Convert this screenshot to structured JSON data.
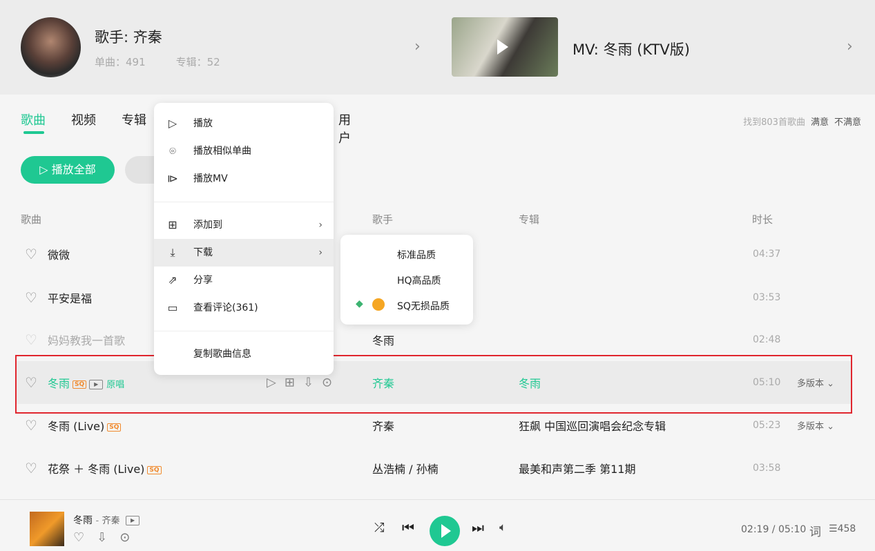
{
  "header": {
    "singer": "歌手: 齐秦",
    "singles": "单曲：491",
    "albums": "专辑：52",
    "mv_title": "MV: 冬雨 (KTV版)"
  },
  "tabs": [
    "歌曲",
    "视频",
    "专辑",
    "用户"
  ],
  "found": {
    "text": "找到803首歌曲",
    "satisfied": "满意",
    "unsatisfied": "不满意"
  },
  "play_all": "播放全部",
  "columns": {
    "song": "歌曲",
    "singer": "歌手",
    "album": "专辑",
    "duration": "时长"
  },
  "rows": [
    {
      "title": "微微",
      "singer": "",
      "album": "",
      "duration": "04:37"
    },
    {
      "title": "平安是福",
      "singer": "",
      "album": "",
      "duration": "03:53"
    },
    {
      "title": "妈妈教我一首歌",
      "singer": "冬雨",
      "album": "",
      "duration": "02:48"
    },
    {
      "title": "冬雨",
      "tag": "原唱",
      "singer": "齐秦",
      "album": "冬雨",
      "duration": "05:10",
      "versions": "多版本"
    },
    {
      "title": "冬雨 (Live)",
      "singer": "齐秦",
      "album": "狂飙 中国巡回演唱会纪念专辑",
      "duration": "05:23",
      "versions": "多版本"
    },
    {
      "title": "花祭 ＋ 冬雨 (Live)",
      "singer": "丛浩楠 / 孙楠",
      "album": "最美和声第二季 第11期",
      "duration": "03:58"
    }
  ],
  "sq_badge": "SQ",
  "context_menu": {
    "play": "播放",
    "play_similar": "播放相似单曲",
    "play_mv": "播放MV",
    "add_to": "添加到",
    "download": "下载",
    "share": "分享",
    "comments": "查看评论(361)",
    "copy_info": "复制歌曲信息"
  },
  "download_submenu": [
    "标准品质",
    "HQ高品质",
    "SQ无损品质"
  ],
  "player": {
    "title": "冬雨",
    "artist": "齐秦",
    "time": "02:19 / 05:10",
    "lyrics": "词",
    "queue_count": "458"
  },
  "colors": {
    "accent": "#1fc892",
    "highlight": "#e0262e"
  }
}
